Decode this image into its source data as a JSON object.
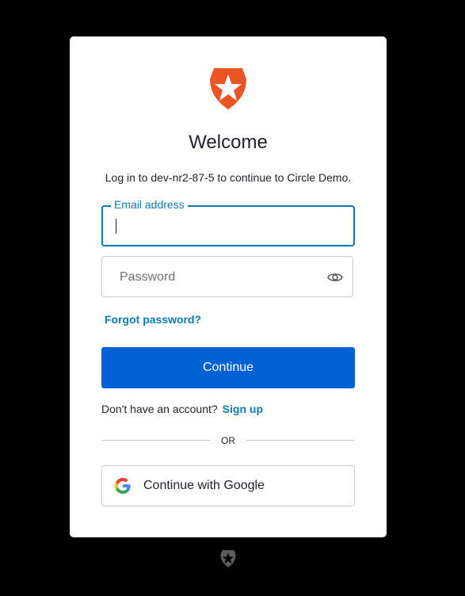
{
  "brand": {
    "logo_icon": "auth0-shield-star",
    "accent": "#eb5424",
    "link": "#0d7bb0",
    "primary": "#0061d5"
  },
  "header": {
    "title": "Welcome",
    "subtitle": "Log in to dev-nr2-87-5 to continue to Circle Demo."
  },
  "form": {
    "email": {
      "label": "Email address",
      "value": ""
    },
    "password": {
      "placeholder": "Password",
      "toggle_icon": "eye-icon"
    },
    "forgot_label": "Forgot password?",
    "continue_label": "Continue"
  },
  "signup": {
    "prompt": "Don't have an account?",
    "link_label": "Sign up"
  },
  "divider_label": "OR",
  "social": {
    "google_label": "Continue with Google"
  },
  "footer": {
    "icon": "auth0-shield-star"
  }
}
